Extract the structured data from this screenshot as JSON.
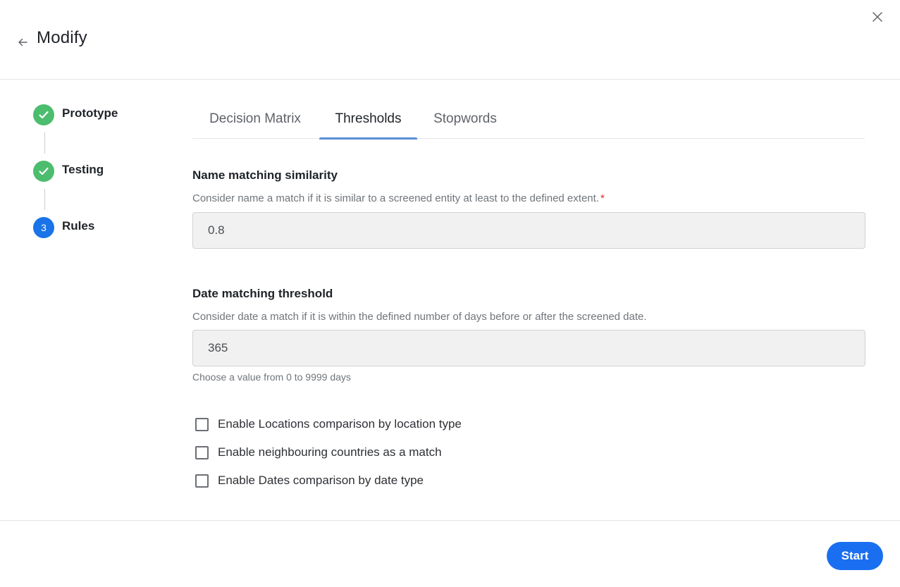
{
  "header": {
    "title": "Modify",
    "back_icon": "arrow-left-icon",
    "close_icon": "close-icon"
  },
  "stepper": {
    "steps": [
      {
        "label": "Prototype",
        "status": "done",
        "icon": "check-icon"
      },
      {
        "label": "Testing",
        "status": "done",
        "icon": "check-icon"
      },
      {
        "label": "Rules",
        "status": "active",
        "number": "3"
      }
    ]
  },
  "tabs": [
    {
      "label": "Decision Matrix",
      "active": false
    },
    {
      "label": "Thresholds",
      "active": true
    },
    {
      "label": "Stopwords",
      "active": false
    }
  ],
  "name_matching": {
    "title": "Name matching similarity",
    "description": "Consider name a match if it is similar to a screened entity at least to the defined extent.",
    "required_mark": "*",
    "value": "0.8"
  },
  "date_matching": {
    "title": "Date matching threshold",
    "description": "Consider date a match if it is within the defined number of days before or after the screened date.",
    "value": "365",
    "helper": "Choose a value from 0 to 9999 days"
  },
  "options": [
    {
      "label": "Enable Locations comparison by location type",
      "checked": false
    },
    {
      "label": "Enable neighbouring countries as a match",
      "checked": false
    },
    {
      "label": "Enable Dates comparison by date type",
      "checked": false
    }
  ],
  "footer": {
    "start_label": "Start"
  },
  "colors": {
    "accent": "#1a6ff0",
    "step_done": "#4cbd6e",
    "step_active": "#1a73e8",
    "tab_indicator": "#5b8fd9",
    "required": "#d93025"
  }
}
